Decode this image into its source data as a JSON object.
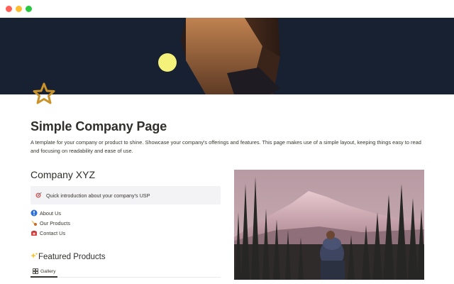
{
  "window": {
    "controls": [
      "close",
      "minimize",
      "maximize"
    ]
  },
  "cover": {
    "image": "dark-cubes-cover",
    "colors": {
      "background": "#172132",
      "sun": "#f4f27a",
      "cube": "#8a5634"
    }
  },
  "page": {
    "icon": "star-icon",
    "title": "Simple Company Page",
    "description": "A template for your company or product to shine. Showcase your company's offerings and features. This page makes use of a simple layout, keeping things easy to read and focusing on readability and ease of use."
  },
  "company": {
    "title": "Company XYZ",
    "callout": {
      "icon": "target-icon",
      "text": "Quick introduction about your company's USP"
    },
    "links": [
      {
        "icon": "info-icon",
        "label": "About Us"
      },
      {
        "icon": "comet-icon",
        "label": "Our Products"
      },
      {
        "icon": "telephone-icon",
        "label": "Contact Us"
      }
    ]
  },
  "featured": {
    "icon": "sparkles-icon",
    "title": "Featured Products",
    "view_tab": {
      "icon": "grid-icon",
      "label": "Gallery"
    }
  },
  "photo": {
    "image": "hiker-mountain-forest-photo"
  }
}
